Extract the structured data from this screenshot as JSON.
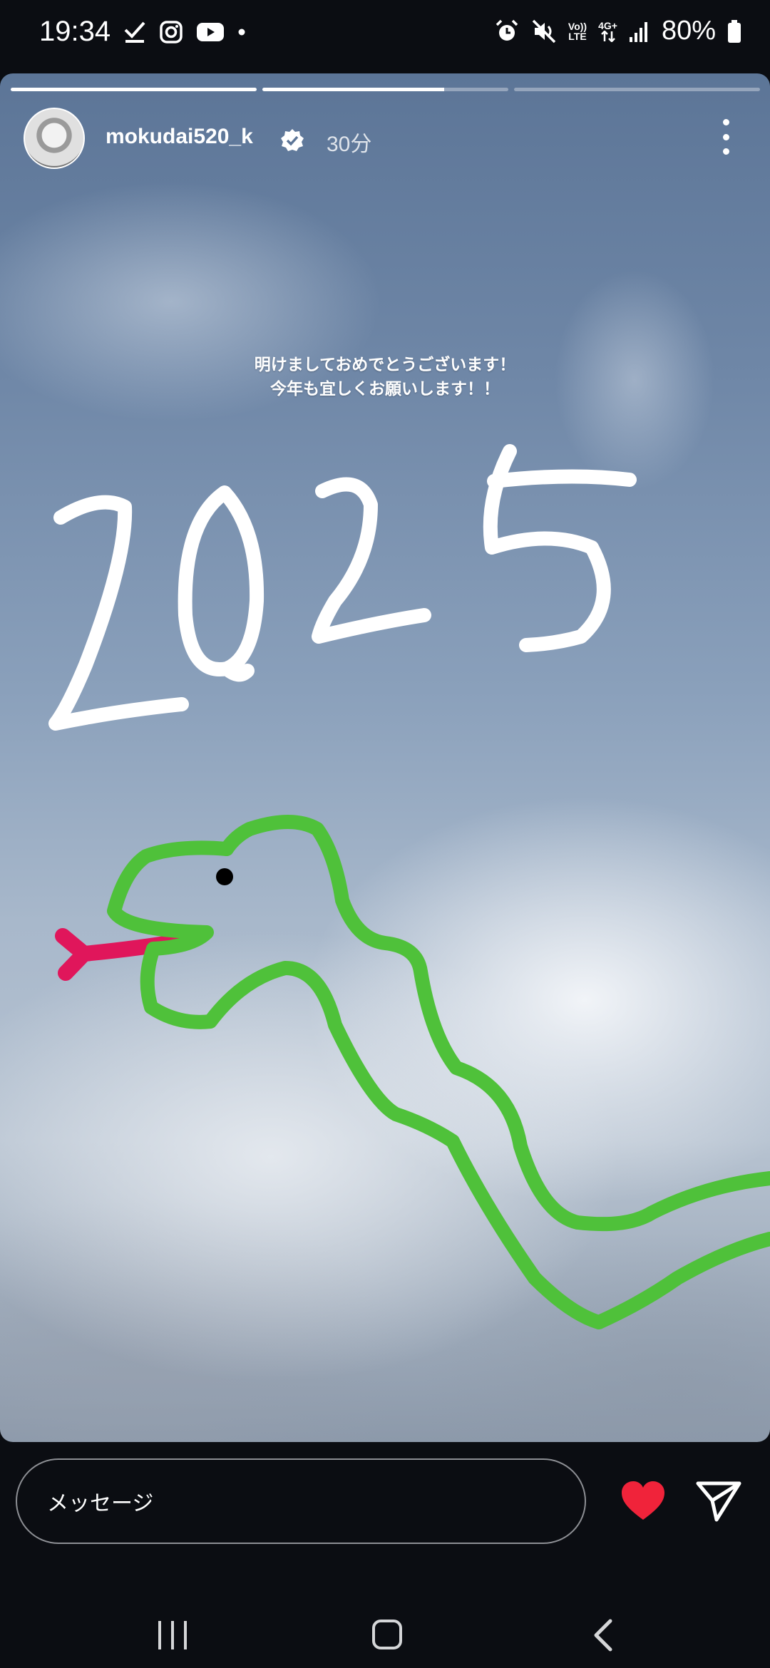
{
  "status_bar": {
    "time": "19:34",
    "left_icons": [
      "check-icon",
      "instagram-icon",
      "youtube-icon",
      "notification-dot"
    ],
    "right_icons": [
      "alarm-icon",
      "mute-icon",
      "volte-icon",
      "4g-icon",
      "signal-icon",
      "battery-icon"
    ],
    "volte_label_top": "Vo))",
    "volte_label_bottom": "LTE",
    "network_label": "4G+",
    "battery": "80%"
  },
  "story": {
    "progress": [
      1.0,
      0.74,
      0.0
    ],
    "username": "mokudai520_k",
    "verified": true,
    "time_ago": "30分",
    "greeting_line1": "明けましておめでとうございます！",
    "greeting_line2": "今年も宜しくお願いします！！",
    "drawing": {
      "year_text_color": "#ffffff",
      "snake_color": "#4fc13a",
      "tongue_color": "#e0165b",
      "eye_color": "#000000"
    }
  },
  "reply_bar": {
    "message_placeholder": "メッセージ",
    "like_color": "#f0233a"
  },
  "nav_bar": {
    "buttons": [
      "recent-apps",
      "home",
      "back"
    ]
  }
}
